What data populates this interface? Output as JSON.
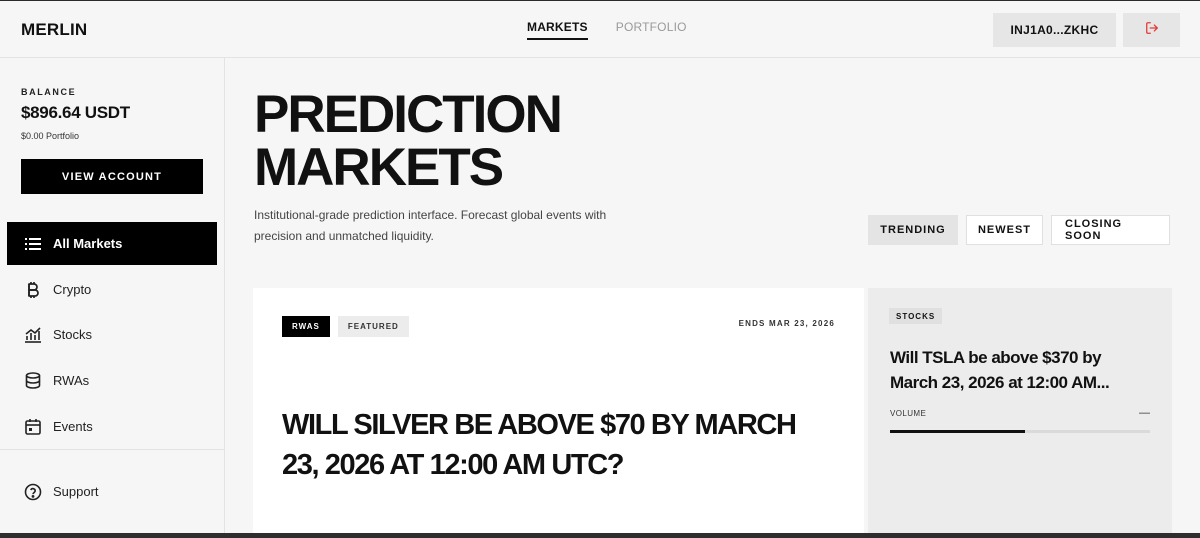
{
  "header": {
    "logo": "MERLIN",
    "nav": [
      {
        "label": "MARKETS",
        "active": true
      },
      {
        "label": "PORTFOLIO",
        "active": false
      }
    ],
    "wallet": "INJ1A0...ZKHC",
    "logout_icon": "logout-icon",
    "logout_color": "#e53935"
  },
  "sidebar": {
    "balance_label": "BALANCE",
    "balance_value": "$896.64 USDT",
    "portfolio_value": "$0.00 Portfolio",
    "view_account": "VIEW ACCOUNT",
    "items": [
      {
        "label": "All Markets",
        "icon": "list-icon",
        "active": true
      },
      {
        "label": "Crypto",
        "icon": "bitcoin-icon",
        "active": false
      },
      {
        "label": "Stocks",
        "icon": "bar-chart-icon",
        "active": false
      },
      {
        "label": "RWAs",
        "icon": "database-icon",
        "active": false
      },
      {
        "label": "Events",
        "icon": "calendar-icon",
        "active": false
      }
    ],
    "support": {
      "label": "Support",
      "icon": "help-circle-icon"
    }
  },
  "main": {
    "title_line1": "PREDICTION",
    "title_line2": "MARKETS",
    "subtitle": "Institutional-grade prediction interface. Forecast global events with precision and unmatched liquidity.",
    "filters": [
      {
        "label": "TRENDING",
        "active": true
      },
      {
        "label": "NEWEST",
        "active": false
      },
      {
        "label": "CLOSING SOON",
        "active": false
      }
    ],
    "featured": {
      "tags": [
        "RWAS",
        "FEATURED"
      ],
      "ends": "ENDS MAR 23, 2026",
      "question": "WILL SILVER BE ABOVE $70 BY MARCH 23, 2026 AT 12:00 AM UTC?"
    },
    "market_card": {
      "tag": "STOCKS",
      "question": "Will TSLA be above $370 by March 23, 2026 at 12:00 AM...",
      "volume_label": "VOLUME",
      "volume_value": "—",
      "volume_fraction": 0.52
    }
  }
}
